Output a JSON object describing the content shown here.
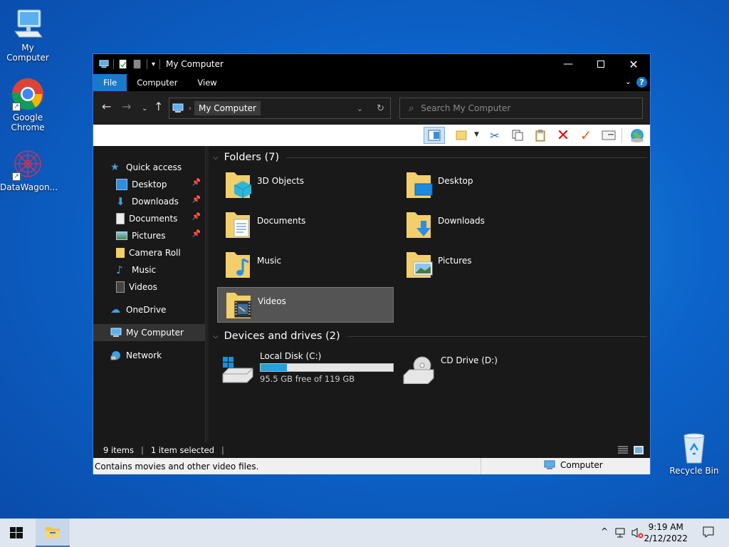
{
  "desktop": {
    "icons": [
      {
        "label": "My Computer"
      },
      {
        "label": "Google Chrome"
      },
      {
        "label": "DataWagon..."
      },
      {
        "label": "Recycle Bin"
      }
    ]
  },
  "window": {
    "title": "My Computer",
    "ribbon_tabs": [
      "File",
      "Computer",
      "View"
    ],
    "address_crumb": "My Computer",
    "search_placeholder": "Search My Computer",
    "nav": {
      "quick_access": "Quick access",
      "quick_items": [
        "Desktop",
        "Downloads",
        "Documents",
        "Pictures",
        "Camera Roll",
        "Music",
        "Videos"
      ],
      "onedrive": "OneDrive",
      "my_computer": "My Computer",
      "network": "Network"
    },
    "folders_header": "Folders (7)",
    "folders": [
      "3D Objects",
      "Desktop",
      "Documents",
      "Downloads",
      "Music",
      "Pictures",
      "Videos"
    ],
    "selected_folder": "Videos",
    "devices_header": "Devices and drives (2)",
    "drives": [
      {
        "name": "Local Disk (C:)",
        "free_text": "95.5 GB free of 119 GB",
        "used_fraction": 0.2
      },
      {
        "name": "CD Drive (D:)"
      }
    ],
    "status": {
      "items": "9 items",
      "selected": "1 item selected"
    },
    "info": {
      "tip": "Contains movies and other video files.",
      "location": "Computer"
    }
  },
  "taskbar": {
    "time": "9:19 AM",
    "date": "2/12/2022"
  },
  "colors": {
    "accent": "#1979ca",
    "window_bg": "#191919",
    "selection": "#545454"
  }
}
